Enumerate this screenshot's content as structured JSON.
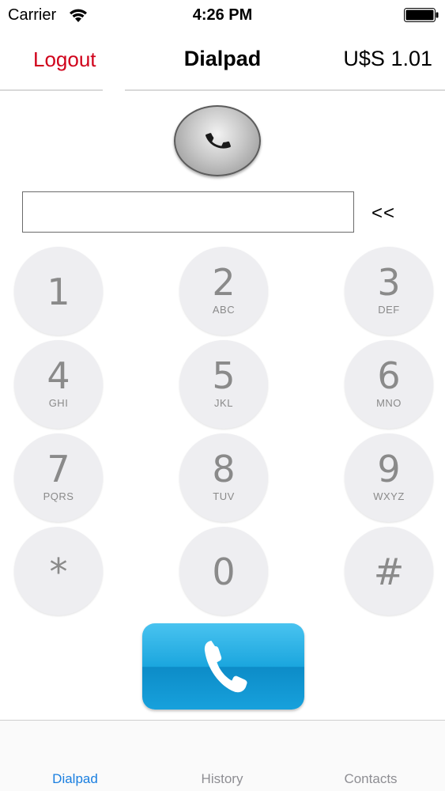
{
  "status_bar": {
    "carrier": "Carrier",
    "time": "4:26 PM"
  },
  "nav": {
    "logout_label": "Logout",
    "title": "Dialpad",
    "balance": "U$S 1.01",
    "logout_color": "#d0021b"
  },
  "dial": {
    "number_value": "",
    "backspace_label": "<<"
  },
  "keypad": {
    "keys": [
      {
        "digit": "1",
        "letters": ""
      },
      {
        "digit": "2",
        "letters": "ABC"
      },
      {
        "digit": "3",
        "letters": "DEF"
      },
      {
        "digit": "4",
        "letters": "GHI"
      },
      {
        "digit": "5",
        "letters": "JKL"
      },
      {
        "digit": "6",
        "letters": "MNO"
      },
      {
        "digit": "7",
        "letters": "PQRS"
      },
      {
        "digit": "8",
        "letters": "TUV"
      },
      {
        "digit": "9",
        "letters": "WXYZ"
      },
      {
        "digit": "*",
        "letters": ""
      },
      {
        "digit": "0",
        "letters": ""
      },
      {
        "digit": "#",
        "letters": ""
      }
    ]
  },
  "call_buttons": {
    "small_icon": "phone-icon",
    "big_icon": "phone-icon",
    "big_color": "#1ba6de"
  },
  "tab_bar": {
    "tabs": [
      {
        "label": "Dialpad",
        "active": true
      },
      {
        "label": "History",
        "active": false
      },
      {
        "label": "Contacts",
        "active": false
      }
    ],
    "active_color": "#1a7fe0"
  }
}
